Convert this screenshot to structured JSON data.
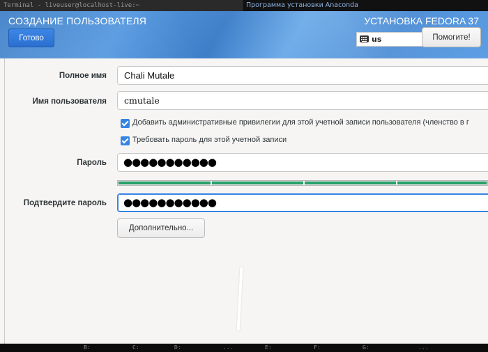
{
  "wm": {
    "terminal_title": "Terminal - liveuser@localhost-live:~",
    "anaconda_title": "Программа установки Anaconda"
  },
  "header": {
    "spoke_title": "СОЗДАНИЕ ПОЛЬЗОВАТЕЛЯ",
    "done_label": "Готово",
    "install_title": "УСТАНОВКА FEDORA 37",
    "keyboard_layout": "us",
    "help_label": "Помогите!"
  },
  "form": {
    "fullname_label": "Полное имя",
    "fullname_value": "Chali Mutale",
    "username_label": "Имя пользователя",
    "username_value": "cmutale",
    "admin_checkbox_label": "Добавить административные привилегии для этой учетной записи пользователя (членство в г",
    "admin_checked": true,
    "require_pwd_label": "Требовать пароль для этой учетной записи",
    "require_pwd_checked": true,
    "password_label": "Пароль",
    "password_value": "●●●●●●●●●●●",
    "password_strength": 1.0,
    "confirm_label": "Подтвердите пароль",
    "confirm_value": "●●●●●●●●●●●",
    "advanced_label": "Дополнительно..."
  },
  "taskbar": {
    "items": [
      "B:",
      "C:",
      "D:",
      "...",
      "E:",
      "F:",
      "G:",
      "..."
    ]
  },
  "colors": {
    "accent": "#3584e4",
    "header_blue": "#4a8bd5",
    "strength_green": "#26a269"
  }
}
